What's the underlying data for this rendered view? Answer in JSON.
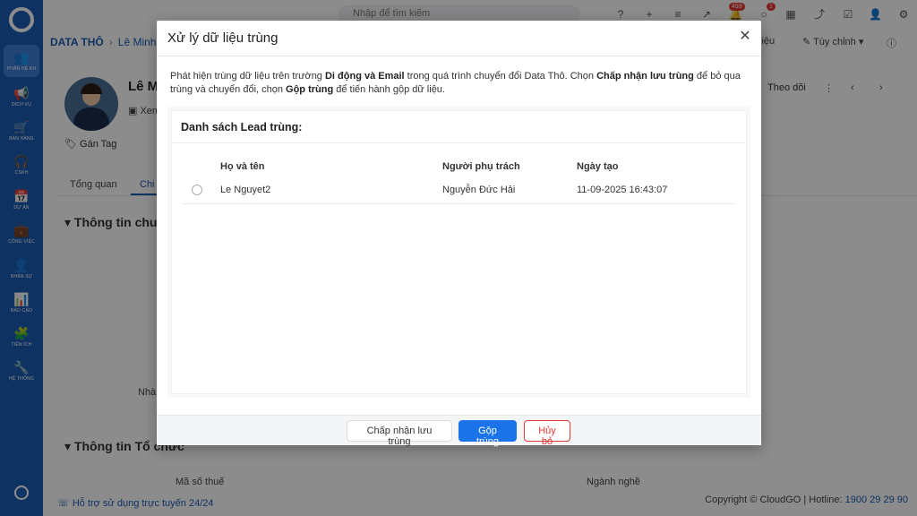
{
  "sidebar": {
    "items": [
      {
        "icon": "people-icon",
        "label": "PHÂN HỆ KH"
      },
      {
        "icon": "megaphone-icon",
        "label": "DỊCH VỤ"
      },
      {
        "icon": "cart-icon",
        "label": "BÁN HÀNG"
      },
      {
        "icon": "headset-icon",
        "label": "CSKH"
      },
      {
        "icon": "calendar-icon",
        "label": "DỰ ÁN"
      },
      {
        "icon": "briefcase-icon",
        "label": "CÔNG VIỆC"
      },
      {
        "icon": "person-icon",
        "label": "NHÂN SỰ"
      },
      {
        "icon": "report-icon",
        "label": "BÁO CÁO"
      },
      {
        "icon": "plugin-icon",
        "label": "TIỆN ÍCH"
      },
      {
        "icon": "wrench-icon",
        "label": "HỆ THỐNG"
      }
    ]
  },
  "topbar": {
    "search_placeholder": "Nhập để tìm kiếm",
    "notif_count": "493",
    "msg_count": "1"
  },
  "breadcrumb": {
    "root": "DATA THÔ",
    "current": "Lê Minh N"
  },
  "record": {
    "name": "Lê M",
    "view_label": "Xem",
    "tag_label": "Gán Tag",
    "follow_label": "Theo dõi",
    "data_label": "liệu",
    "customize_label": "Tùy chỉnh"
  },
  "tabs": {
    "overview": "Tổng quan",
    "detail": "Chi"
  },
  "sections": {
    "contact": "Thông tin chu",
    "org": "Thông tin Tổ chức",
    "nha": "Nhà",
    "tax": "Mã số thuế",
    "industry": "Ngành nghề"
  },
  "footer": {
    "help": "Hỗ trợ sử dụng trực tuyến 24/24",
    "copyright": "Copyright © CloudGO | Hotline: ",
    "hotline": "1900 29 29 90"
  },
  "modal": {
    "title": "Xử lý dữ liệu trùng",
    "desc_1": "Phát hiện trùng dữ liệu trên trường ",
    "desc_fields": "Di động và Email",
    "desc_2": " trong quá trình chuyển đổi Data Thô. Chọn ",
    "desc_accept": "Chấp nhận lưu trùng",
    "desc_3": " để bỏ qua trùng và chuyển đổi, chọn ",
    "desc_merge": "Gộp trùng",
    "desc_4": " để tiến hành gộp dữ liệu.",
    "list_title": "Danh sách Lead trùng:",
    "columns": {
      "name": "Họ và tên",
      "owner": "Người phụ trách",
      "created": "Ngày tạo"
    },
    "rows": [
      {
        "name": "Le Nguyet2",
        "owner": "Nguyễn Đức Hải",
        "created": "11-09-2025 16:43:07"
      }
    ],
    "buttons": {
      "accept": "Chấp nhận lưu trùng",
      "merge": "Gộp trùng",
      "cancel": "Hủy bỏ"
    }
  },
  "colors": {
    "primary": "#1a73e8",
    "sidebar": "#1a5bb3",
    "danger": "#e53935"
  }
}
